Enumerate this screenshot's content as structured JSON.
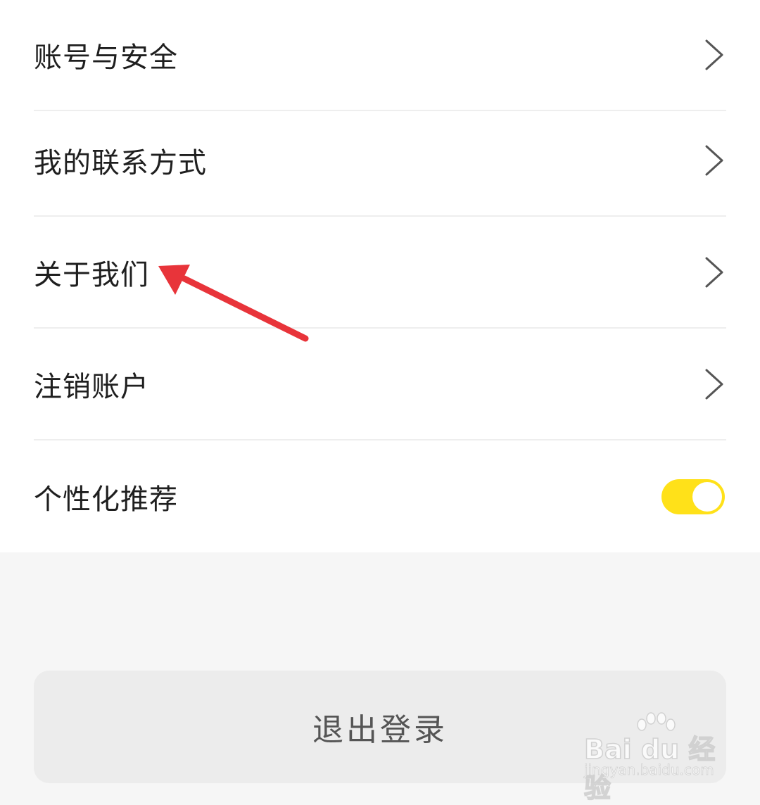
{
  "settings": {
    "items": [
      {
        "label": "账号与安全",
        "control": "chevron-right-icon"
      },
      {
        "label": "我的联系方式",
        "control": "chevron-right-icon"
      },
      {
        "label": "关于我们",
        "control": "chevron-right-icon"
      },
      {
        "label": "注销账户",
        "control": "chevron-right-icon"
      },
      {
        "label": "个性化推荐",
        "control": "toggle",
        "toggle_on": true
      }
    ]
  },
  "logout": {
    "label": "退出登录"
  },
  "annotation": {
    "icon": "red-arrow-icon",
    "color": "#e8343a"
  },
  "watermark": {
    "brand": "Bai du 经验",
    "url": "jingyan.baidu.com"
  },
  "colors": {
    "toggle_on": "#ffe119",
    "background": "#f6f6f6",
    "card": "#ffffff",
    "logout_button": "#ececec"
  }
}
